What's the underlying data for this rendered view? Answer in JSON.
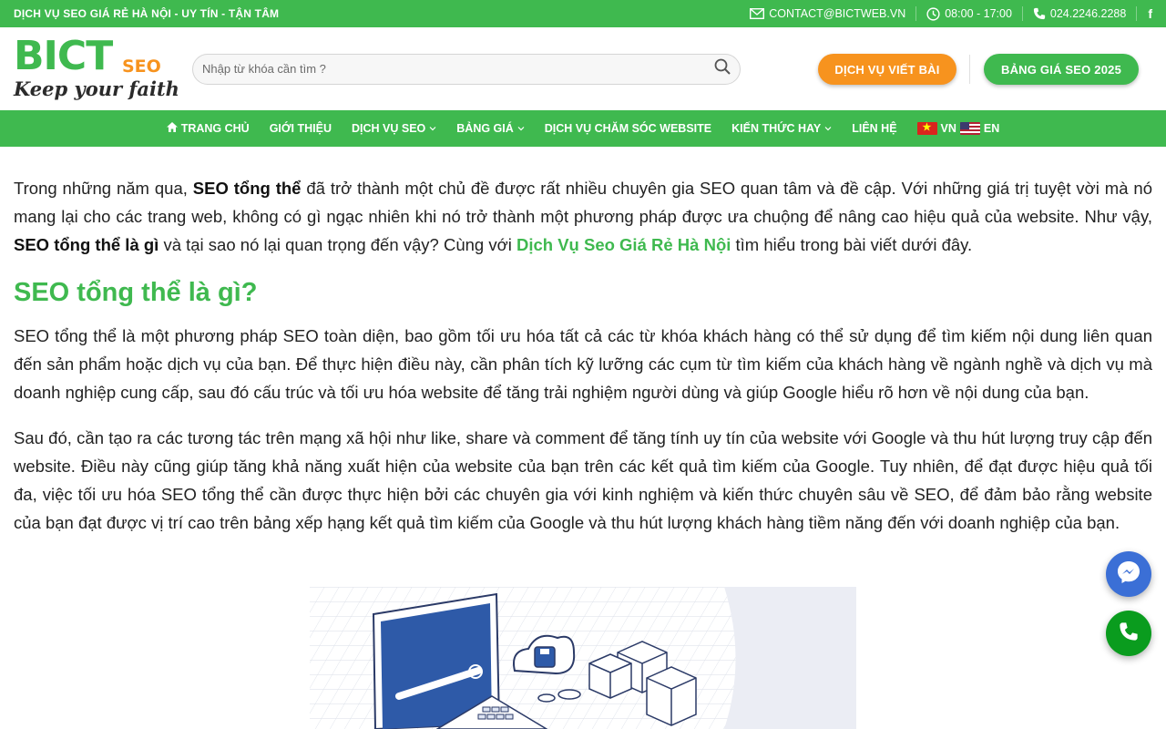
{
  "topbar": {
    "tagline": "DỊCH VỤ SEO GIÁ RẺ HÀ NỘI - UY TÍN - TẬN TÂM",
    "email": "CONTACT@BICTWEB.VN",
    "hours": "08:00 - 17:00",
    "phone": "024.2246.2288",
    "facebook": "f"
  },
  "logo": {
    "brand": "BICT",
    "suffix": "SEO",
    "slogan": "Keep your faith"
  },
  "search": {
    "placeholder": "Nhập từ khóa cần tìm ?"
  },
  "header_buttons": {
    "writing": "DỊCH VỤ VIẾT BÀI",
    "pricing": "BẢNG GIÁ SEO 2025"
  },
  "nav": {
    "home": "TRANG CHỦ",
    "about": "GIỚI THIỆU",
    "seo_service": "DỊCH VỤ SEO",
    "pricing": "BẢNG GIÁ",
    "website_care": "DỊCH VỤ CHĂM SÓC WEBSITE",
    "knowledge": "KIẾN THỨC HAY",
    "contact": "LIÊN HỆ",
    "lang_vn": "VN",
    "lang_en": "EN"
  },
  "article": {
    "p1_a": "Trong những năm qua, ",
    "p1_b": "SEO tổng thể",
    "p1_c": " đã trở thành một chủ đề được rất nhiều chuyên gia SEO quan tâm và đề cập. Với những giá trị tuyệt vời mà nó mang lại cho các trang web, không có gì ngạc nhiên khi nó trở thành một phương pháp được ưa chuộng để nâng cao hiệu quả của website. Như vậy, ",
    "p1_d": "SEO tổng thể là gì",
    "p1_e": " và tại sao nó lại quan trọng đến vậy? Cùng với ",
    "p1_link": "Dịch Vụ Seo Giá Rẻ Hà Nội",
    "p1_f": " tìm hiểu trong bài viết dưới đây.",
    "h2": "SEO tổng thể là gì?",
    "p2": "SEO tổng thể là một phương pháp SEO toàn diện, bao gồm tối ưu hóa tất cả các từ khóa khách hàng có thể sử dụng để tìm kiếm nội dung liên quan đến sản phẩm hoặc dịch vụ của bạn. Để thực hiện điều này, cần phân tích kỹ lưỡng các cụm từ tìm kiếm của khách hàng về ngành nghề và dịch vụ mà doanh nghiệp cung cấp, sau đó cấu trúc và tối ưu hóa website để tăng trải nghiệm người dùng và giúp Google hiểu rõ hơn về nội dung của bạn.",
    "p3": "Sau đó, cần tạo ra các tương tác trên mạng xã hội như like, share và comment để tăng tính uy tín của website với Google và thu hút lượng truy cập đến website. Điều này cũng giúp tăng khả năng xuất hiện của website của bạn trên các kết quả tìm kiếm của Google. Tuy nhiên, để đạt được hiệu quả tối đa, việc tối ưu hóa SEO tổng thể cần được thực hiện bởi các chuyên gia với kinh nghiệm và kiến thức chuyên sâu về SEO, để đảm bảo rằng website của bạn đạt được vị trí cao trên bảng xếp hạng kết quả tìm kiếm của Google và thu hút lượng khách hàng tiềm năng đến với doanh nghiệp của bạn."
  },
  "colors": {
    "brand_green": "#3fb94f",
    "brand_orange": "#f7931e",
    "messenger_blue": "#3b6fd6",
    "phone_green": "#0a9c1e"
  },
  "icons": {
    "email": "envelope-icon",
    "hours": "clock-icon",
    "phone": "phone-icon",
    "search": "magnifier-icon",
    "home": "home-icon",
    "messenger": "messenger-icon"
  }
}
